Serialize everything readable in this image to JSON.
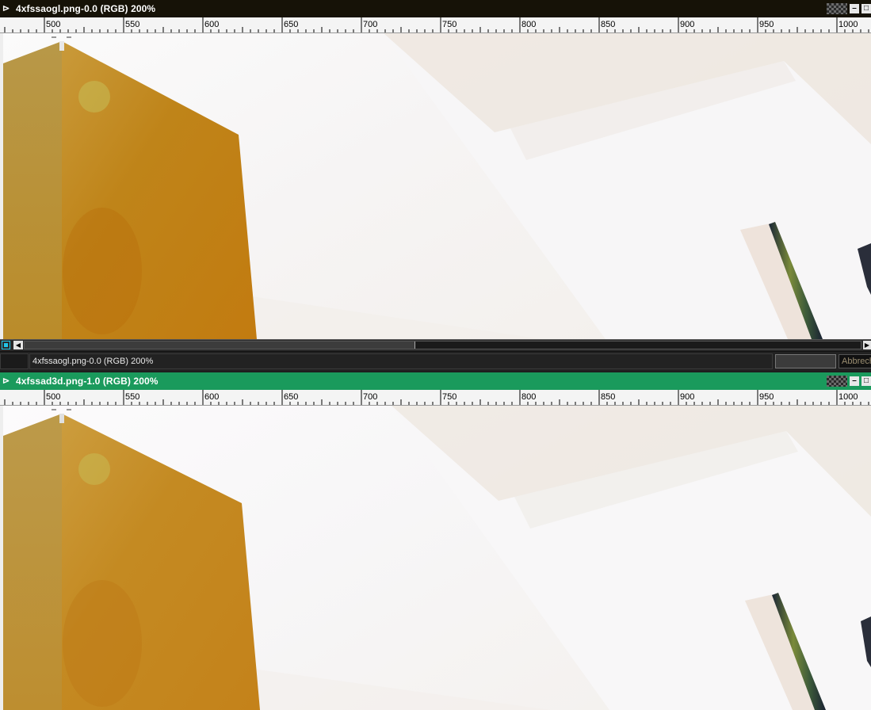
{
  "windows": [
    {
      "title": "4xfssaogl.png-0.0 (RGB) 200%",
      "title_bg": "#161207",
      "status_text": "4xfssaogl.png-0.0 (RGB) 200%",
      "status_button": "Abbrechen"
    },
    {
      "title": "4xfssad3d.png-1.0 (RGB) 200%",
      "title_bg": "#1a9a5c"
    }
  ],
  "ruler": {
    "labels": [
      "500",
      "550",
      "600",
      "650",
      "700",
      "750",
      "800",
      "850",
      "900",
      "950",
      "1000"
    ]
  },
  "titlebar_buttons": {
    "pin": "⊳",
    "minimize": "–",
    "maximize": "□"
  },
  "scroll_arrows": {
    "left": "◀",
    "right": "▶"
  },
  "colors": {
    "accent": "#21c4e6",
    "active_title": "#1a9a5c",
    "inactive_title": "#161207"
  },
  "icons": [
    "pin-icon",
    "navigate-icon",
    "minimize-icon",
    "maximize-icon"
  ]
}
